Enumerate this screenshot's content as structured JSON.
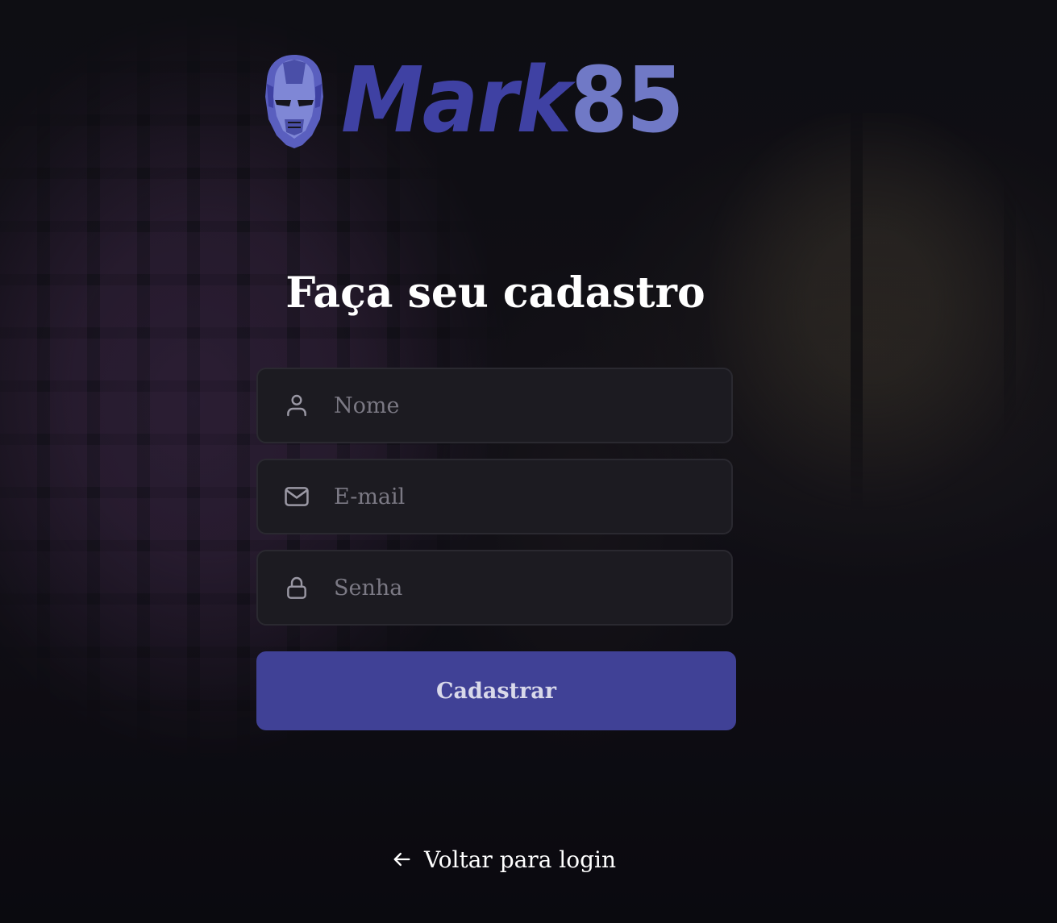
{
  "brand": {
    "logo_word": "Mark",
    "logo_number": "85",
    "logo_icon": "iron-helmet-icon",
    "primary_color": "#404196",
    "accent_color": "#7079c6"
  },
  "form": {
    "title": "Faça seu cadastro",
    "name_field": {
      "placeholder": "Nome",
      "value": "",
      "icon": "user-icon"
    },
    "email_field": {
      "placeholder": "E-mail",
      "value": "",
      "icon": "mail-icon"
    },
    "password_field": {
      "placeholder": "Senha",
      "value": "",
      "icon": "lock-icon"
    },
    "submit_label": "Cadastrar"
  },
  "footer": {
    "back_link_label": "Voltar para login",
    "back_icon": "arrow-left-icon"
  }
}
